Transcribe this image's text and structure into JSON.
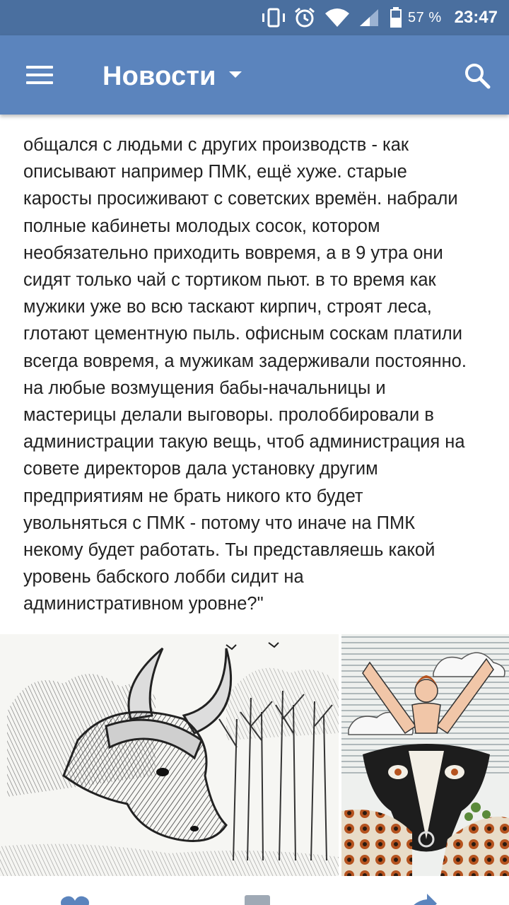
{
  "status_bar": {
    "battery_percent": "57 %",
    "time": "23:47",
    "icons": [
      "vibrate-icon",
      "alarm-icon",
      "wifi-icon",
      "signal-icon",
      "battery-icon"
    ]
  },
  "app_bar": {
    "title": "Новости",
    "menu_icon": "hamburger-menu-icon",
    "dropdown_icon": "caret-down-icon",
    "search_icon": "search-icon"
  },
  "post": {
    "text": "общался с людьми с других производств - как\nописывают например ПМК, ещё хуже. старые\nкаросты просиживают с советских времён. набрали\nполные кабинеты молодых сосок, котором\nнеобязательно приходить вовремя, а в 9 утра они\nсидят только чай с тортиком пьют. в то время как\nмужики уже во всю таскают кирпич, строят леса,\nглотают цементную пыль. офисным соскам платили\nвсегда вовремя, а мужикам задерживали постоянно.\nна любые возмущения бабы-начальницы и\nмастерицы делали выговоры. пролоббировали в\nадминистрации такую вещь, чтоб администрация на\nсовете директоров дала установку другим\nпредприятиям не брать никого кто будет\nувольняться с ПМК - потому что иначе на ПМК\nнекому будет работать. Ты представляешь какой\nуровень бабского лобби сидит на\nадминистративном уровне?\""
  },
  "colors": {
    "status_bar": "#4a6f9f",
    "app_bar": "#5b84bd",
    "text": "#222222",
    "action_icons": "#5b84bd"
  },
  "actions": {
    "icons": [
      "like-icon",
      "comment-icon",
      "share-icon"
    ]
  }
}
